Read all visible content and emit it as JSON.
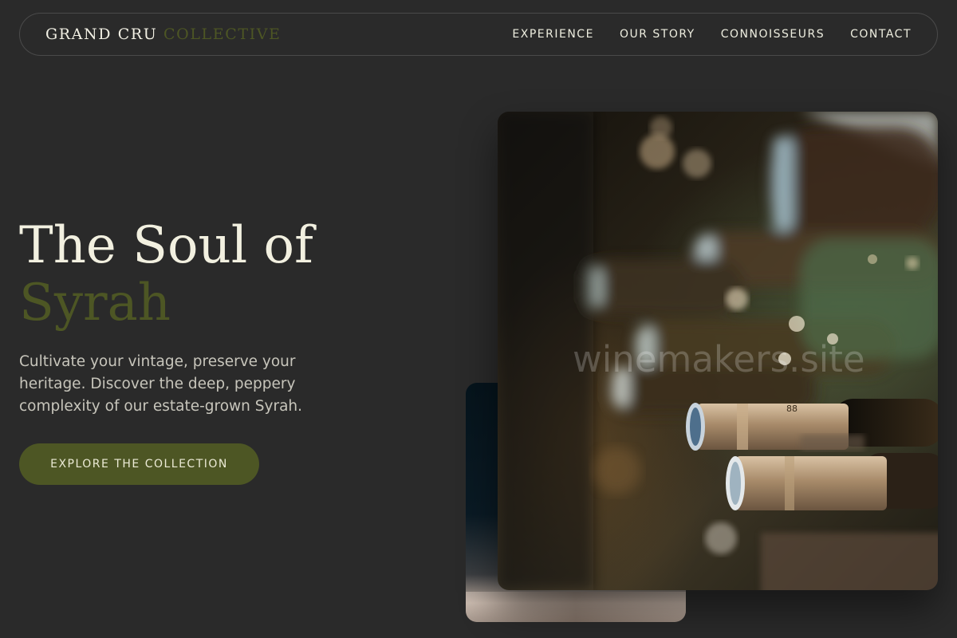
{
  "brand": {
    "primary": "GRAND CRU",
    "accent": "COLLECTIVE"
  },
  "nav": {
    "links": [
      {
        "label": "EXPERIENCE"
      },
      {
        "label": "OUR STORY"
      },
      {
        "label": "CONNOISSEURS"
      },
      {
        "label": "CONTACT"
      }
    ]
  },
  "hero": {
    "title_line1": "The Soul of",
    "title_line2": "Syrah",
    "description": "Cultivate your vintage, preserve your heritage. Discover the deep, peppery complexity of our estate-grown Syrah.",
    "cta_label": "EXPLORE THE COLLECTION"
  },
  "image": {
    "watermark": "winemakers.site",
    "bottle_mark": "88"
  },
  "colors": {
    "background": "#2a2a2a",
    "accent_olive": "#4d5624",
    "text_cream": "#f2f0e0"
  }
}
